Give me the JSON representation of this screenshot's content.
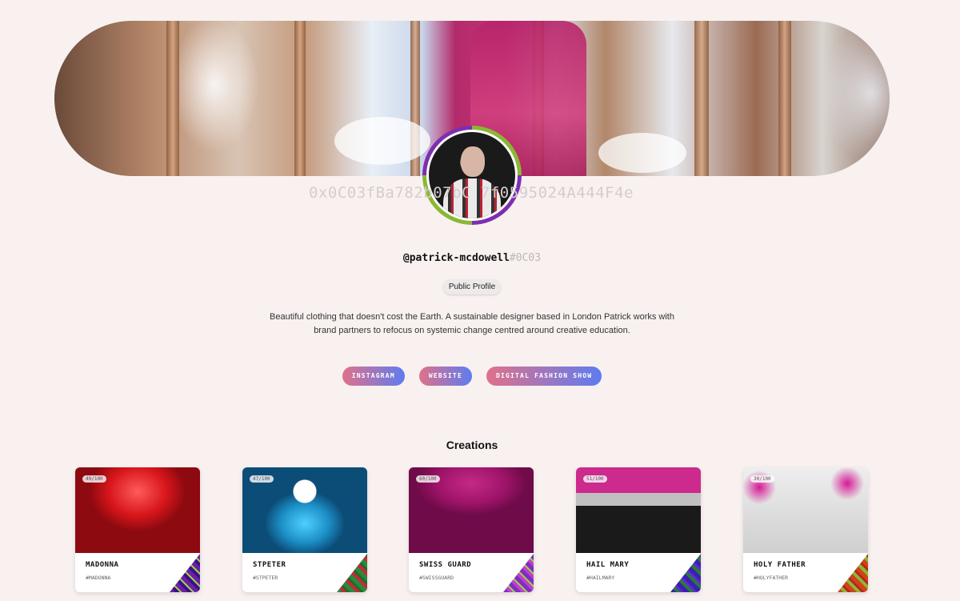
{
  "profile": {
    "address": "0x0C03fBa782b07bC   7f0595024A444F4e",
    "handle": "@patrick-mcdowell",
    "handle_suffix": "#0C03",
    "badge": "Public Profile",
    "bio": "Beautiful clothing that doesn't cost the Earth. A sustainable designer based in London Patrick works with brand partners to refocus on systemic change centred around creative education."
  },
  "links": [
    "INSTAGRAM",
    "WEBSITE",
    "DIGITAL FASHION SHOW"
  ],
  "creations": {
    "title": "Creations",
    "items": [
      {
        "name": "MADONNA",
        "tag": "#MADONNA",
        "count": "49/100",
        "art_color": "#d8161b",
        "corner": "#6b1fa8"
      },
      {
        "name": "STPETER",
        "tag": "#STPETER",
        "count": "47/100",
        "art_color": "#1c8fc6",
        "corner": "#2b8a3a"
      },
      {
        "name": "SWISS GUARD",
        "tag": "#SWISSGUARD",
        "count": "60/100",
        "art_color": "#a0146a",
        "corner": "#7c2fc0"
      },
      {
        "name": "HAIL MARY",
        "tag": "#HAILMARY",
        "count": "51/100",
        "art_color": "#1a1a1a",
        "corner": "#3d1fb0"
      },
      {
        "name": "HOLY FATHER",
        "tag": "#HOLYFATHER",
        "count": "30/100",
        "art_color": "#d9d9d9",
        "corner": "#d0421b"
      }
    ]
  }
}
